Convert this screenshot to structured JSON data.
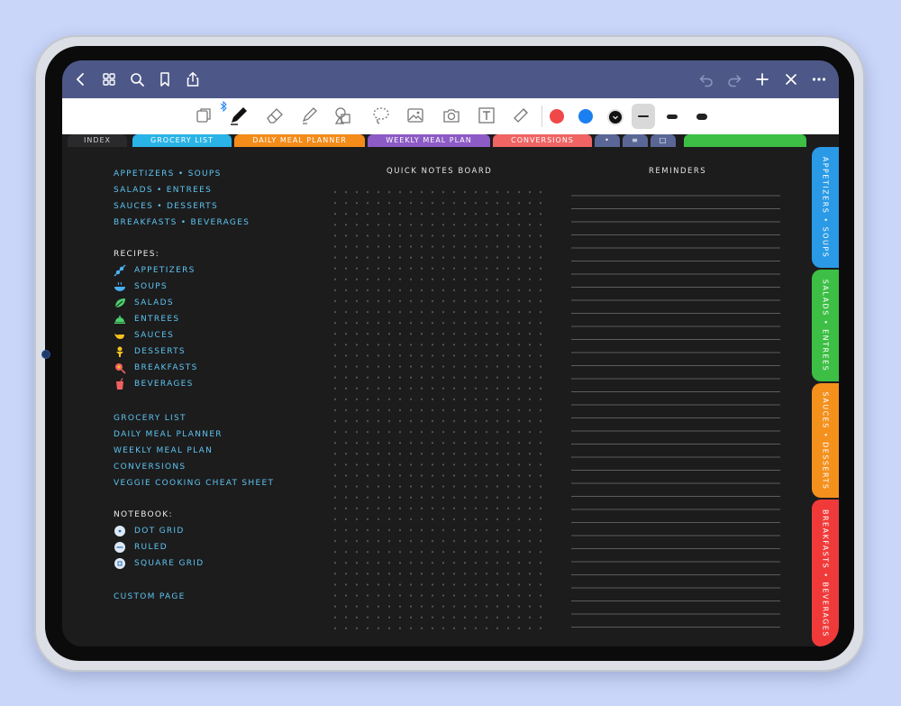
{
  "toolbar_colors": {
    "red": "#f04848",
    "blue": "#1a7ff0",
    "black": "#111111"
  },
  "top_tabs": [
    {
      "label": "INDEX",
      "color": "#2a2a2c"
    },
    {
      "label": "GROCERY LIST",
      "color": "#2ab3e6"
    },
    {
      "label": "DAILY MEAL PLANNER",
      "color": "#f48c1a"
    },
    {
      "label": "WEEKLY MEAL PLAN",
      "color": "#8d5bc6"
    },
    {
      "label": "CONVERSIONS",
      "color": "#f06464"
    }
  ],
  "small_tabs": [
    "•",
    "≡",
    "□"
  ],
  "side_tabs": [
    {
      "label": "APPETIZERS • SOUPS",
      "color": "#2a9ae6"
    },
    {
      "label": "SALADS • ENTREES",
      "color": "#3cbf44"
    },
    {
      "label": "SAUCES • DESSERTS",
      "color": "#f4901c"
    },
    {
      "label": "BREAKFASTS • BEVERAGES",
      "color": "#f03a3a"
    }
  ],
  "index": {
    "sections": [
      "APPETIZERS • SOUPS",
      "SALADS • ENTREES",
      "SAUCES • DESSERTS",
      "BREAKFASTS • BEVERAGES"
    ],
    "recipes_heading": "RECIPES:",
    "recipes": [
      {
        "label": "APPETIZERS",
        "icon": "skewer-icon",
        "color": "#4ab0f0"
      },
      {
        "label": "SOUPS",
        "icon": "soup-bowl-icon",
        "color": "#4ab0f0"
      },
      {
        "label": "SALADS",
        "icon": "salad-leaf-icon",
        "color": "#4cd06c"
      },
      {
        "label": "ENTREES",
        "icon": "cloche-icon",
        "color": "#4cd06c"
      },
      {
        "label": "SAUCES",
        "icon": "gravy-boat-icon",
        "color": "#f4c21c"
      },
      {
        "label": "DESSERTS",
        "icon": "dessert-icon",
        "color": "#f4c21c"
      },
      {
        "label": "BREAKFASTS",
        "icon": "breakfast-icon",
        "color": "#f06060"
      },
      {
        "label": "BEVERAGES",
        "icon": "drink-cup-icon",
        "color": "#f06060"
      }
    ],
    "pages": [
      "GROCERY LIST",
      "DAILY MEAL PLANNER",
      "WEEKLY MEAL PLAN",
      "CONVERSIONS",
      "VEGGIE COOKING CHEAT SHEET"
    ],
    "notebook_heading": "NOTEBOOK:",
    "notebook": [
      {
        "label": "DOT GRID",
        "icon": "dot-grid-icon"
      },
      {
        "label": "RULED",
        "icon": "ruled-icon"
      },
      {
        "label": "SQUARE GRID",
        "icon": "square-grid-icon"
      }
    ],
    "custom_page": "CUSTOM PAGE"
  },
  "quick_notes_title": "QUICK NOTES BOARD",
  "reminders_title": "REMINDERS"
}
